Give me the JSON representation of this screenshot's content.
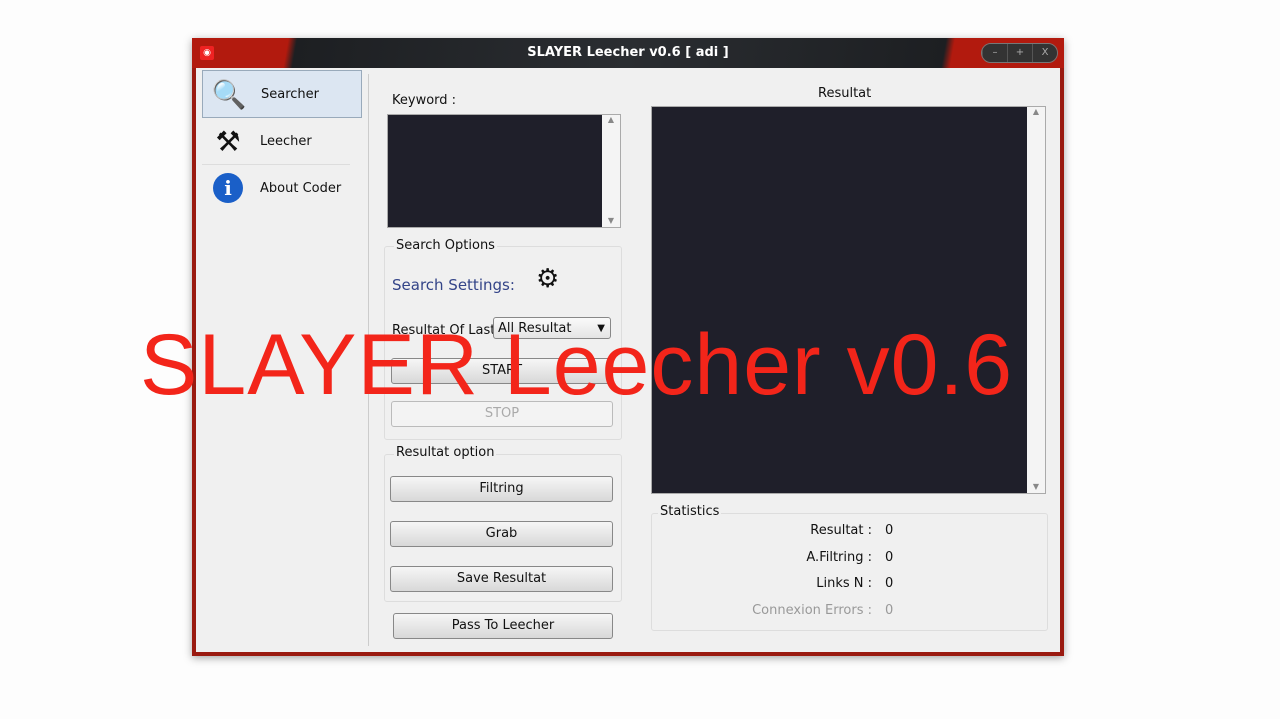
{
  "window": {
    "title": "SLAYER Leecher v0.6 [ adi ]",
    "controls": [
      "–",
      "+",
      "X"
    ]
  },
  "nav": {
    "items": [
      {
        "label": "Searcher",
        "icon": "magnifier-icon"
      },
      {
        "label": "Leecher",
        "icon": "tools-icon"
      },
      {
        "label": "About Coder",
        "icon": "info-icon"
      }
    ]
  },
  "search": {
    "keyword_label": "Keyword :",
    "options_title": "Search Options",
    "settings_label": "Search Settings:",
    "result_of_last_label": "Resultat Of Last",
    "result_select": "All Resultat",
    "start": "START",
    "stop": "STOP"
  },
  "result_option": {
    "title": "Resultat option",
    "filtring": "Filtring",
    "grab": "Grab",
    "save": "Save Resultat",
    "pass": "Pass To Leecher"
  },
  "results": {
    "title": "Resultat"
  },
  "statistics": {
    "title": "Statistics",
    "rows": [
      {
        "label": "Resultat :",
        "value": "0"
      },
      {
        "label": "A.Filtring :",
        "value": "0"
      },
      {
        "label": "Links N :",
        "value": "0"
      },
      {
        "label": "Connexion Errors :",
        "value": "0"
      }
    ]
  },
  "watermark": "SLAYER Leecher v0.6",
  "colors": {
    "accent": "#b21a0e",
    "watermark": "#f3251a",
    "textbox": "#1f1f2a"
  }
}
